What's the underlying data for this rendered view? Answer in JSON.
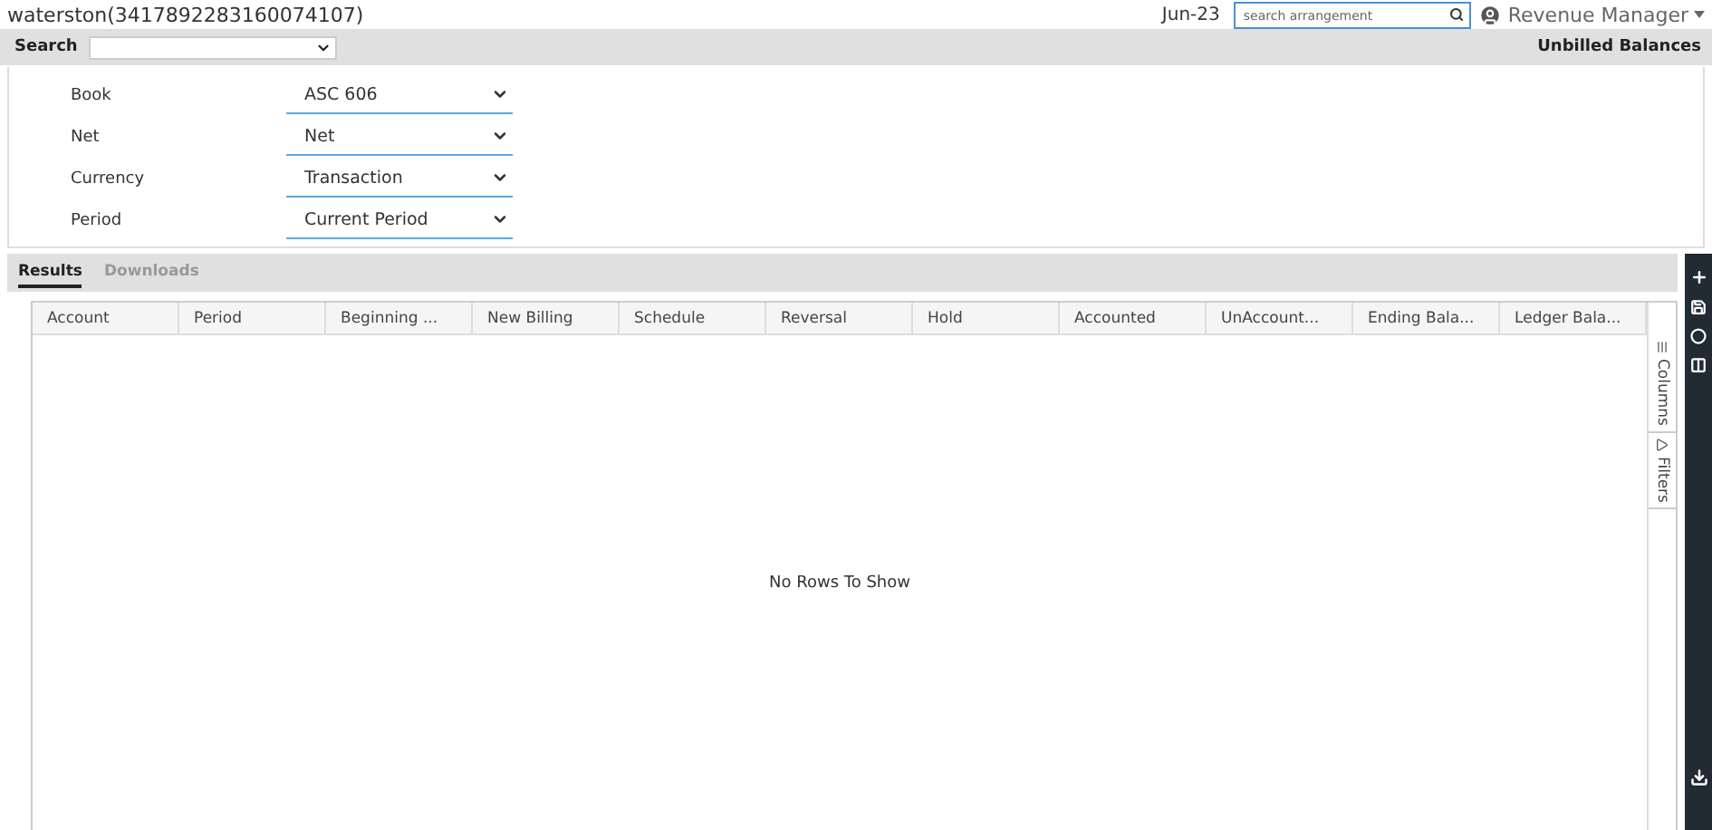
{
  "header": {
    "title": "waterston(3417892283160074107)",
    "period": "Jun-23",
    "search": {
      "placeholder": "search arrangement"
    },
    "user": "Revenue Manager"
  },
  "search_bar": {
    "label": "Search",
    "report": "Unbilled Balances"
  },
  "filters": [
    {
      "label": "Book",
      "value": "ASC 606"
    },
    {
      "label": "Net",
      "value": "Net"
    },
    {
      "label": "Currency",
      "value": "Transaction"
    },
    {
      "label": "Period",
      "value": "Current Period"
    }
  ],
  "tabs": [
    {
      "label": "Results",
      "selected": true
    },
    {
      "label": "Downloads",
      "selected": false
    }
  ],
  "table": {
    "columns": [
      "Account",
      "Period",
      "Beginning ...",
      "New Billing",
      "Schedule",
      "Reversal",
      "Hold",
      "Accounted",
      "UnAccount...",
      "Ending Bala...",
      "Ledger Bala..."
    ],
    "empty_message": "No Rows To Show"
  },
  "side_panel": [
    "Columns",
    "Filters"
  ]
}
